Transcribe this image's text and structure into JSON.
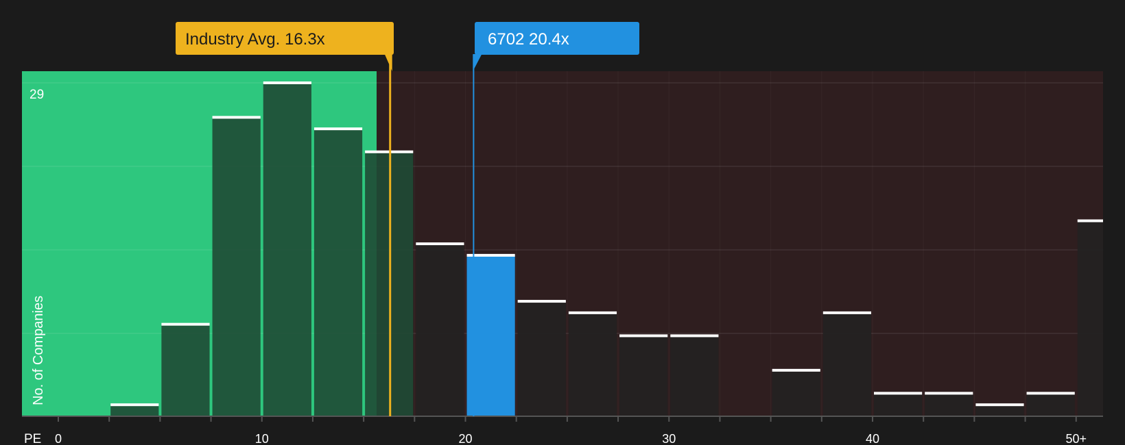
{
  "chart_data": {
    "type": "bar",
    "x_axis_label": "PE",
    "y_axis_label": "No. of Companies",
    "y_max_label": "29",
    "xlim": [
      0,
      51.5
    ],
    "ylim": [
      0,
      29
    ],
    "x_ticks": [
      {
        "value": 0,
        "label": "0"
      },
      {
        "value": 10,
        "label": "10"
      },
      {
        "value": 20,
        "label": "20"
      },
      {
        "value": 30,
        "label": "30"
      },
      {
        "value": 40,
        "label": "40"
      },
      {
        "value": 50,
        "label": "50+"
      }
    ],
    "bins": [
      {
        "x0": 2.5,
        "x1": 5,
        "count": 1
      },
      {
        "x0": 5,
        "x1": 7.5,
        "count": 8
      },
      {
        "x0": 7.5,
        "x1": 10,
        "count": 26
      },
      {
        "x0": 10,
        "x1": 12.5,
        "count": 29
      },
      {
        "x0": 12.5,
        "x1": 15,
        "count": 25
      },
      {
        "x0": 15,
        "x1": 17.5,
        "count": 23
      },
      {
        "x0": 17.5,
        "x1": 20,
        "count": 15
      },
      {
        "x0": 20,
        "x1": 22.5,
        "count": 14,
        "highlight": true
      },
      {
        "x0": 22.5,
        "x1": 25,
        "count": 10
      },
      {
        "x0": 25,
        "x1": 27.5,
        "count": 9
      },
      {
        "x0": 27.5,
        "x1": 30,
        "count": 7
      },
      {
        "x0": 30,
        "x1": 32.5,
        "count": 7
      },
      {
        "x0": 35,
        "x1": 37.5,
        "count": 4
      },
      {
        "x0": 37.5,
        "x1": 40,
        "count": 9
      },
      {
        "x0": 40,
        "x1": 42.5,
        "count": 2
      },
      {
        "x0": 42.5,
        "x1": 45,
        "count": 2
      },
      {
        "x0": 45,
        "x1": 47.5,
        "count": 1
      },
      {
        "x0": 47.5,
        "x1": 50,
        "count": 2
      },
      {
        "x0": 50,
        "x1": 51.5,
        "count": 17
      }
    ],
    "industry_avg": {
      "value": 16.3,
      "label": "Industry Avg. 16.3x"
    },
    "company": {
      "value": 20.4,
      "label": "6702 20.4x"
    },
    "colors": {
      "background": "#1b1b1b",
      "good_zone": "#2ec77e",
      "bad_zone": "#2f1e1f",
      "bar_in_good": "#1f4a35",
      "bar_in_bad": "#242222",
      "highlight": "#2291e0",
      "industry": "#eeb21e",
      "cap": "#ffffff",
      "axis": "#555555"
    }
  }
}
